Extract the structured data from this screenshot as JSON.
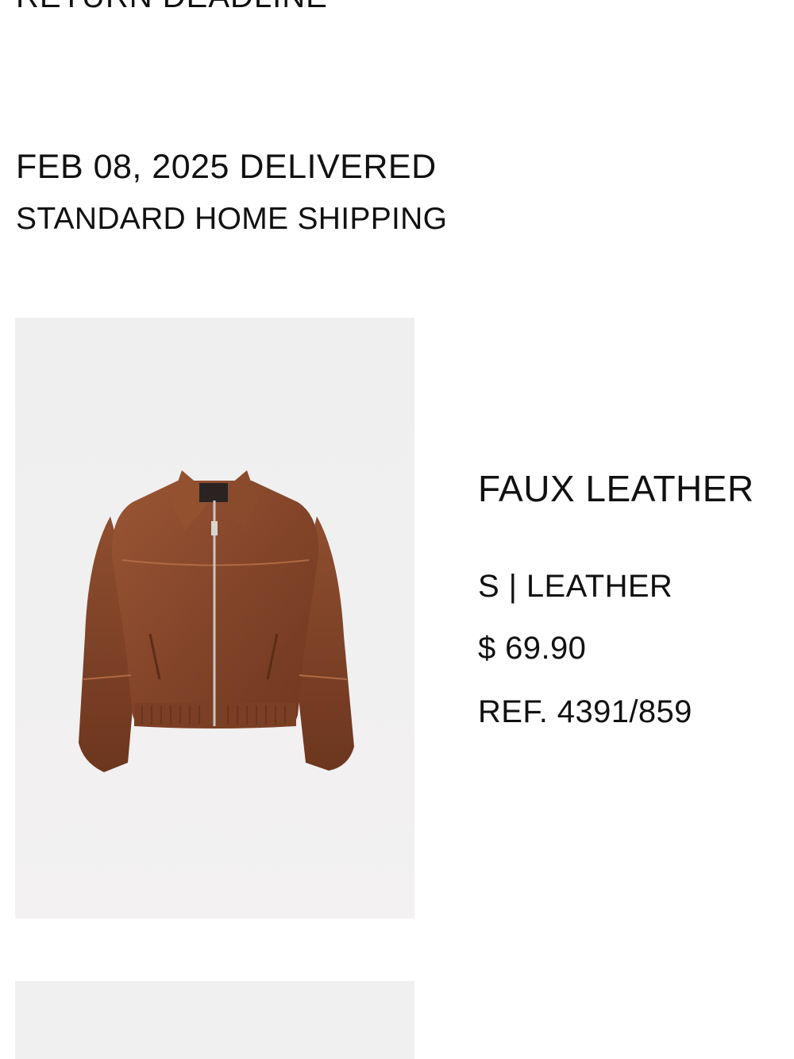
{
  "return_section": {
    "heading": "RETURN DEADLINE"
  },
  "delivery": {
    "status": "FEB 08, 2025 DELIVERED",
    "method": "STANDARD HOME SHIPPING"
  },
  "product": {
    "image_icon": "leather-jacket-image",
    "name": "FAUX LEATHER",
    "variant": "S | LEATHER",
    "price": "$ 69.90",
    "reference": "REF. 4391/859"
  },
  "colors": {
    "text": "#111111",
    "image_background": "#f0eff0",
    "jacket": "#8a4a2c"
  }
}
